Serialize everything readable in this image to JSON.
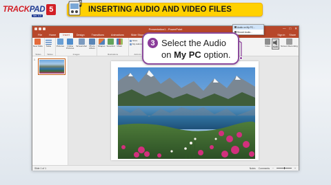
{
  "brand": {
    "name_part1": "TRACK",
    "name_part2": "PAD",
    "version": "5",
    "sub": "Ver. 4.0"
  },
  "header": {
    "title": "INSERTING AUDIO AND VIDEO FILES"
  },
  "window": {
    "title": "Presentation1 - PowerPoint",
    "controls": [
      "—",
      "□",
      "✕"
    ],
    "account": [
      "Sign in",
      "Share"
    ],
    "tabs": [
      "File",
      "Home",
      "Insert",
      "Design",
      "Transitions",
      "Animations",
      "Slide Show",
      "Review",
      "View"
    ],
    "active_tab": "Insert"
  },
  "ribbon": {
    "groups": [
      {
        "label": "Slides",
        "buttons": [
          "New Slide"
        ]
      },
      {
        "label": "Tables",
        "buttons": [
          "Table"
        ]
      },
      {
        "label": "Images",
        "buttons": [
          "Pictures",
          "Online Pictures",
          "Screenshot",
          "Photo Album"
        ]
      },
      {
        "label": "Illustrations",
        "buttons": [
          "Shapes",
          "SmartArt",
          "Chart"
        ]
      },
      {
        "label": "Add-ins",
        "small": [
          "Store",
          "My Add-ins"
        ]
      }
    ],
    "media": {
      "buttons": [
        "Video",
        "Audio",
        "Screen Recording"
      ]
    }
  },
  "dropdown": {
    "items": [
      "Audio on My PC...",
      "Record Audio..."
    ],
    "selected_index": 0
  },
  "callout": {
    "number": "3",
    "line1": "Select the Audio",
    "line2_prefix": "on ",
    "line2_bold": "My PC",
    "line2_suffix": " option."
  },
  "thumbnails": [
    {
      "number": "1"
    }
  ],
  "status": {
    "slide_info": "Slide 1 of 1",
    "notes": "Notes",
    "comments": "Comments",
    "zoom_minus": "−",
    "zoom_plus": "+"
  },
  "colors": {
    "powerpoint_red": "#b7472a",
    "banner_yellow": "#ffd100",
    "callout_purple": "#8b3c9a",
    "brand_red": "#d21f26"
  }
}
